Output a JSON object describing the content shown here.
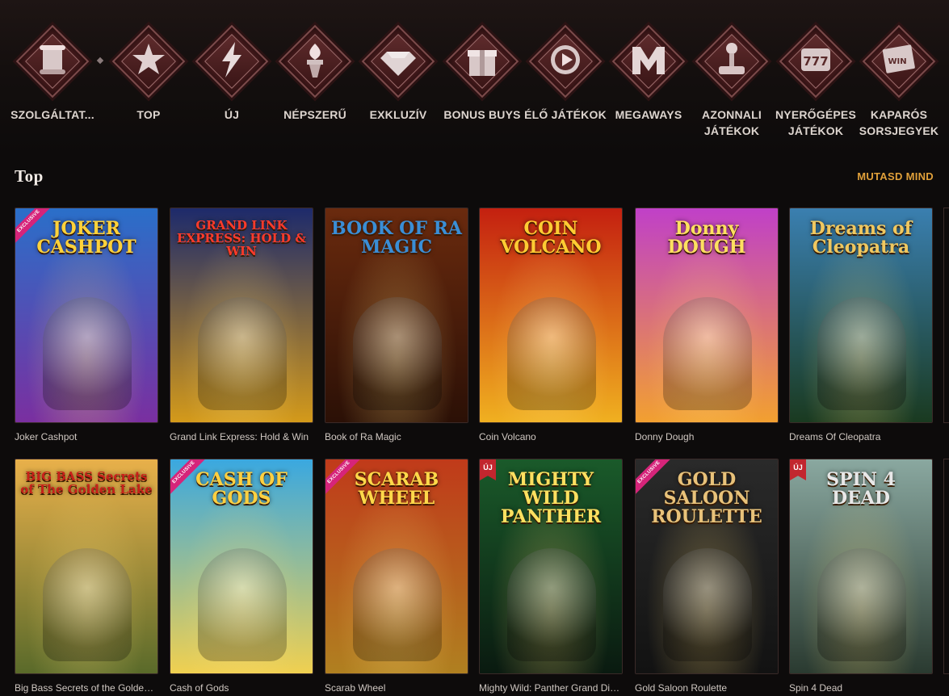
{
  "categories": [
    {
      "label": "SZOLGÁLTAT...",
      "icon": "scroll-icon"
    },
    {
      "label": "TOP",
      "icon": "star-icon"
    },
    {
      "label": "ÚJ",
      "icon": "lightning-icon"
    },
    {
      "label": "NÉPSZERŰ",
      "icon": "torch-icon"
    },
    {
      "label": "EXKLUZÍV",
      "icon": "diamond-icon"
    },
    {
      "label": "BONUS BUYS",
      "icon": "gift-icon"
    },
    {
      "label": "ÉLŐ JÁTÉKOK",
      "icon": "play-icon"
    },
    {
      "label": "MEGAWAYS",
      "icon": "megaways-m-icon"
    },
    {
      "label": "AZONNALI JÁTÉKOK",
      "icon": "joystick-icon"
    },
    {
      "label": "NYERŐGÉPES JÁTÉKOK",
      "icon": "slot-777-icon"
    },
    {
      "label": "KAPARÓS SORSJEGYEK",
      "icon": "scratch-card-icon"
    }
  ],
  "section": {
    "title": "Top",
    "show_all": "MUTASD MIND"
  },
  "badges": {
    "exclusive": "EXCLUSIVE",
    "new": "ÚJ"
  },
  "games": [
    {
      "name": "Joker Cashpot",
      "art_title": "JOKER CASHPOT",
      "exclusive": true,
      "new": false,
      "colors": [
        "#2a6fc9",
        "#7a2fa0"
      ],
      "title_color": "#ffd23a"
    },
    {
      "name": "Grand Link Express: Hold & Win",
      "art_title": "GRAND LINK EXPRESS: HOLD & WIN",
      "exclusive": false,
      "new": false,
      "colors": [
        "#1d2a6b",
        "#d49a1a"
      ],
      "title_color": "#ff3b2b"
    },
    {
      "name": "Book of Ra Magic",
      "art_title": "BOOK OF RA MAGIC",
      "exclusive": false,
      "new": false,
      "colors": [
        "#6a2a0e",
        "#2b1006"
      ],
      "title_color": "#3a8ed6"
    },
    {
      "name": "Coin Volcano",
      "art_title": "COIN VOLCANO",
      "exclusive": false,
      "new": false,
      "colors": [
        "#c42010",
        "#f0b020"
      ],
      "title_color": "#ffcc33"
    },
    {
      "name": "Donny Dough",
      "art_title": "Donny DOUGH",
      "exclusive": false,
      "new": false,
      "colors": [
        "#c040c8",
        "#f2a030"
      ],
      "title_color": "#ffe060"
    },
    {
      "name": "Dreams Of Cleopatra",
      "art_title": "Dreams of Cleopatra",
      "exclusive": false,
      "new": false,
      "colors": [
        "#3a7fb0",
        "#1a3a20"
      ],
      "title_color": "#f0c860"
    },
    {
      "name": "Big Bass Secrets of the Golden L...",
      "art_title": "BIG BASS Secrets of The Golden Lake",
      "exclusive": false,
      "new": false,
      "colors": [
        "#e8b04a",
        "#5a6a2a"
      ],
      "title_color": "#c8201a"
    },
    {
      "name": "Cash of Gods",
      "art_title": "CASH OF GODS",
      "exclusive": true,
      "new": false,
      "colors": [
        "#3aa8e0",
        "#f0d050"
      ],
      "title_color": "#ffd040"
    },
    {
      "name": "Scarab Wheel",
      "art_title": "SCARAB WHEEL",
      "exclusive": true,
      "new": false,
      "colors": [
        "#c03a1a",
        "#b08020"
      ],
      "title_color": "#ffd84a"
    },
    {
      "name": "Mighty Wild: Panther Grand Dia...",
      "art_title": "MIGHTY WILD PANTHER",
      "exclusive": false,
      "new": true,
      "colors": [
        "#1a5a2a",
        "#0a1a10"
      ],
      "title_color": "#ffe060"
    },
    {
      "name": "Gold Saloon Roulette",
      "art_title": "GOLD SALOON ROULETTE",
      "exclusive": true,
      "new": false,
      "colors": [
        "#2a2a2a",
        "#121212"
      ],
      "title_color": "#e8c27a"
    },
    {
      "name": "Spin 4 Dead",
      "art_title": "SPIN 4 DEAD",
      "exclusive": false,
      "new": true,
      "colors": [
        "#8aa8a0",
        "#2a3a30"
      ],
      "title_color": "#e8e8e8"
    }
  ]
}
